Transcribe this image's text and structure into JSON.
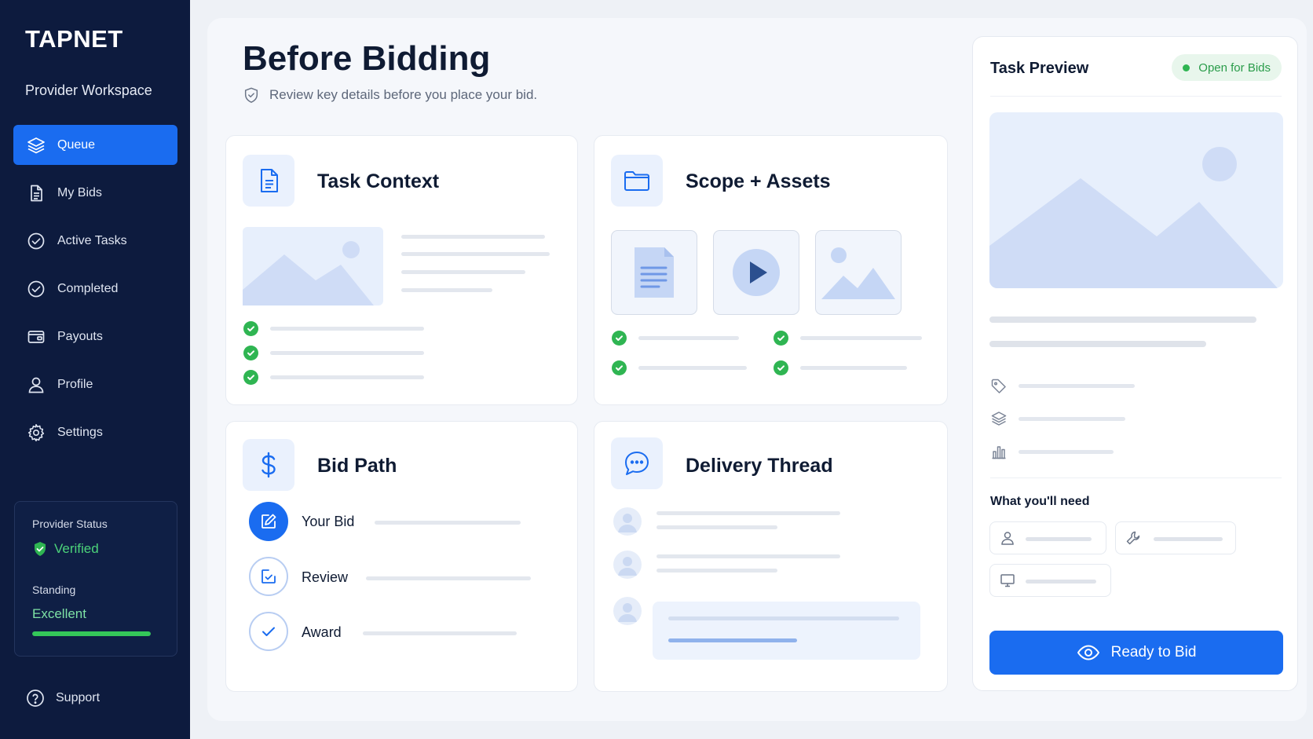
{
  "app": {
    "logo": "TAPNET",
    "workspace": "Provider Workspace"
  },
  "sidebar": {
    "items": [
      {
        "label": "Queue",
        "icon": "layers-icon",
        "active": true
      },
      {
        "label": "My Bids",
        "icon": "document-icon",
        "active": false
      },
      {
        "label": "Active Tasks",
        "icon": "check-circle-icon",
        "active": false
      },
      {
        "label": "Completed",
        "icon": "check-circle-icon",
        "active": false
      },
      {
        "label": "Payouts",
        "icon": "wallet-icon",
        "active": false
      },
      {
        "label": "Profile",
        "icon": "user-icon",
        "active": false
      },
      {
        "label": "Settings",
        "icon": "gear-icon",
        "active": false
      }
    ],
    "status": {
      "label": "Provider Status",
      "value": "Verified",
      "standing_label": "Standing",
      "standing_value": "Excellent",
      "standing_progress": 1.0
    },
    "support": "Support"
  },
  "main": {
    "title": "Before Bidding",
    "subtitle": "Review key details before you place your bid.",
    "cards": {
      "task_context": {
        "title": "Task Context"
      },
      "scope_assets": {
        "title": "Scope + Assets"
      },
      "bid_path": {
        "title": "Bid Path",
        "steps": [
          "Your Bid",
          "Review",
          "Award"
        ]
      },
      "delivery_thread": {
        "title": "Delivery Thread"
      }
    }
  },
  "preview": {
    "title": "Task Preview",
    "badge": "Open for Bids",
    "needs_title": "What you'll need",
    "cta": "Ready to Bid"
  },
  "colors": {
    "sidebar_bg": "#0d1b3e",
    "accent": "#1a6cf0",
    "success": "#2fb552"
  }
}
